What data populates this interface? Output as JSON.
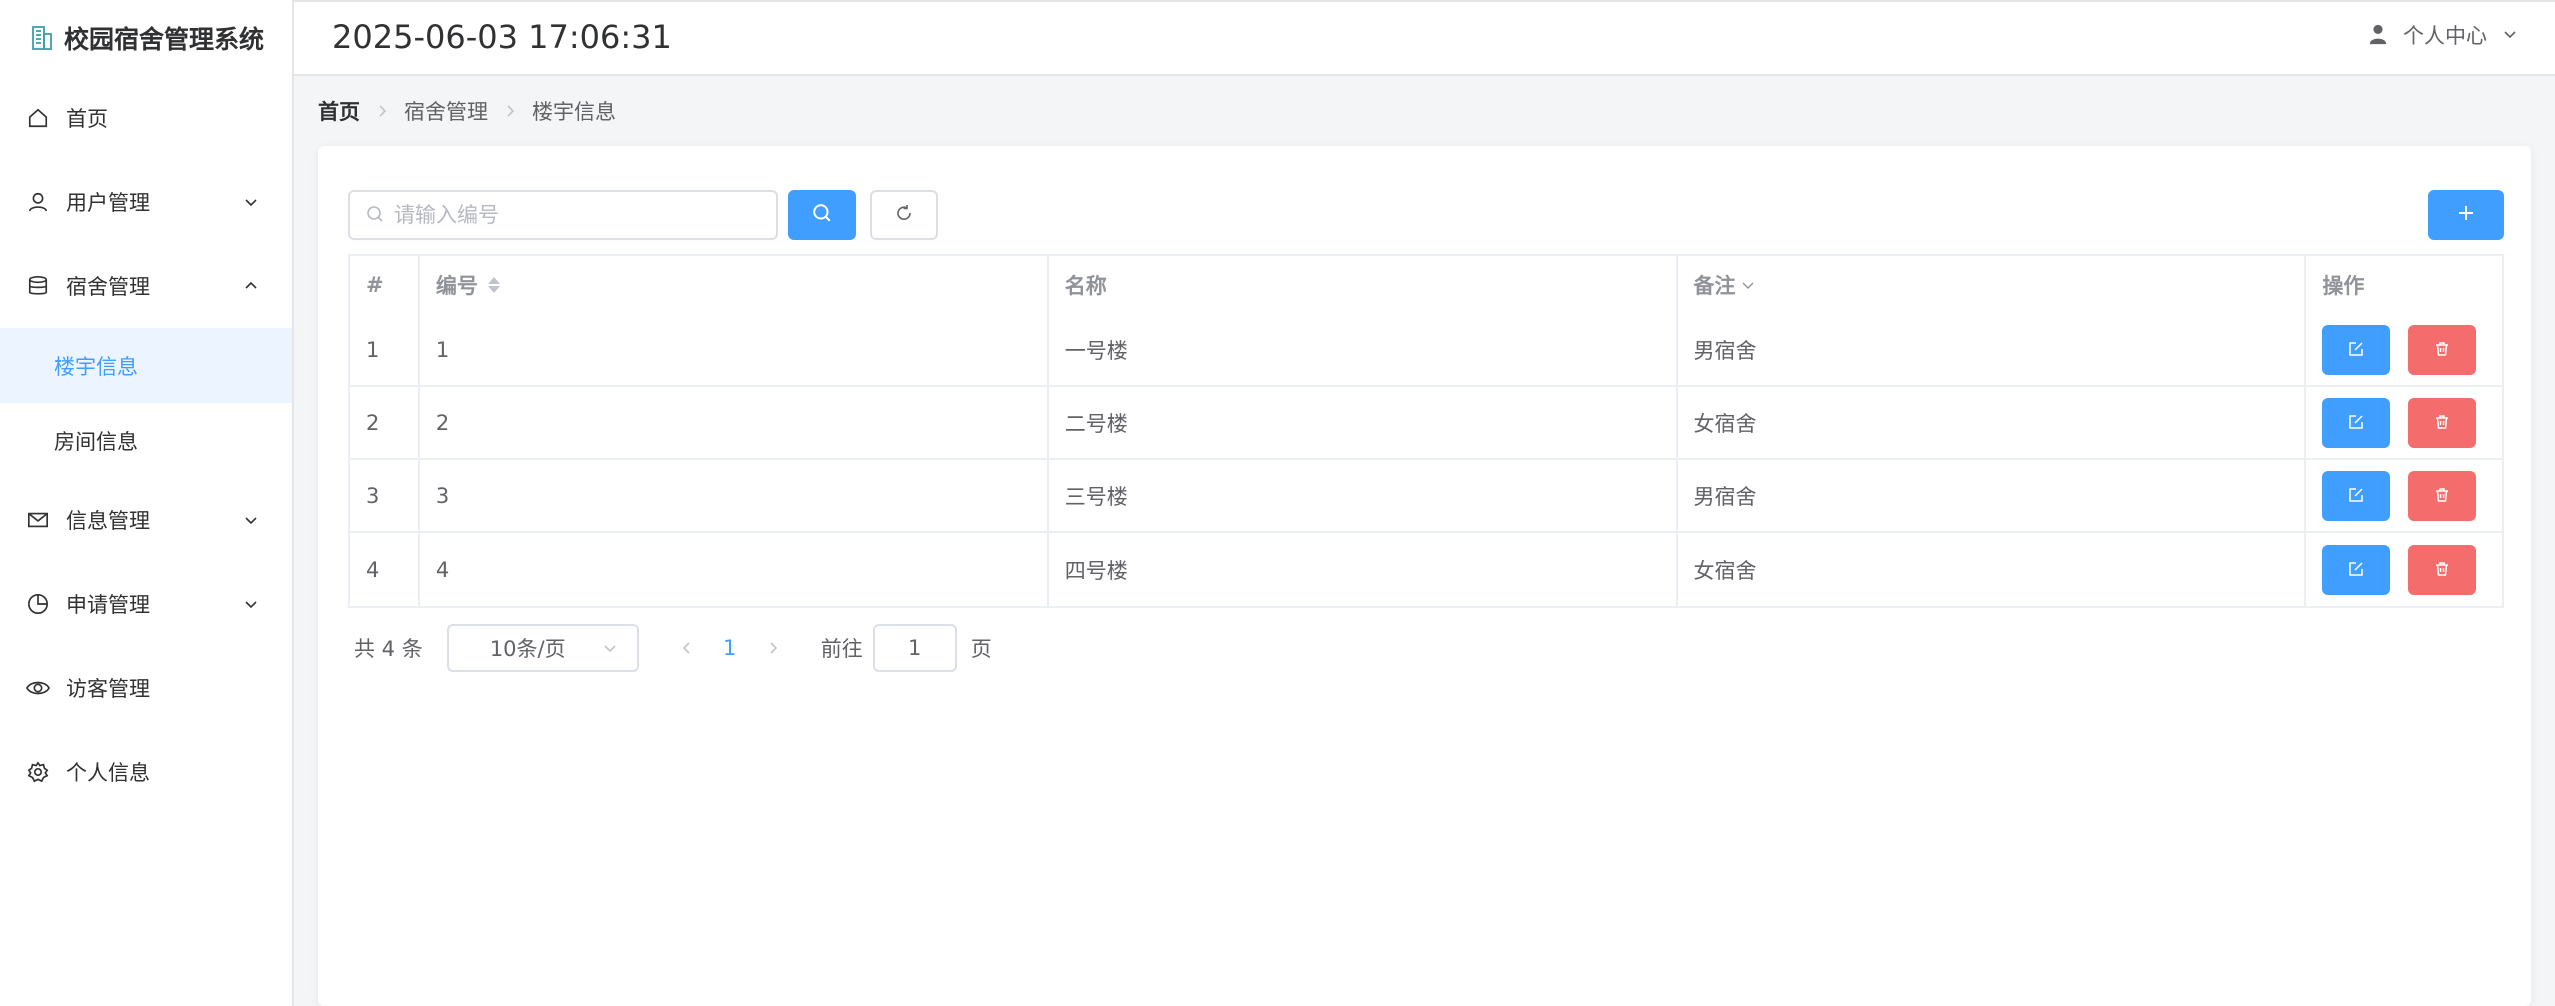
{
  "app": {
    "title": "校园宿舍管理系统",
    "datetime": "2025-06-03 17:06:31"
  },
  "header": {
    "user_menu_label": "个人中心"
  },
  "sidebar": {
    "home": "首页",
    "user_mgmt": "用户管理",
    "dorm_mgmt": "宿舍管理",
    "dorm_sub": {
      "building": "楼宇信息",
      "room": "房间信息"
    },
    "info_mgmt": "信息管理",
    "apply_mgmt": "申请管理",
    "visitor_mgmt": "访客管理",
    "profile": "个人信息"
  },
  "breadcrumb": [
    "首页",
    "宿舍管理",
    "楼宇信息"
  ],
  "search": {
    "placeholder": "请输入编号"
  },
  "table": {
    "headers": [
      "#",
      "编号",
      "名称",
      "备注",
      "操作"
    ],
    "rows": [
      {
        "idx": "1",
        "code": "1",
        "name": "一号楼",
        "remark": "男宿舍"
      },
      {
        "idx": "2",
        "code": "2",
        "name": "二号楼",
        "remark": "女宿舍"
      },
      {
        "idx": "3",
        "code": "3",
        "name": "三号楼",
        "remark": "男宿舍"
      },
      {
        "idx": "4",
        "code": "4",
        "name": "四号楼",
        "remark": "女宿舍"
      }
    ]
  },
  "pagination": {
    "total": "共 4 条",
    "page_size": "10条/页",
    "current_page": "1",
    "goto_label": "前往",
    "goto_value": "1",
    "unit": "页"
  },
  "colors": {
    "primary": "#409eff",
    "danger": "#f56c6c",
    "active_bg": "#ecf5ff"
  },
  "icons": {
    "logo": "building-icon",
    "home": "home-icon",
    "user": "user-icon",
    "dorm": "database-icon",
    "info": "mail-icon",
    "apply": "pie-chart-icon",
    "visitor": "eye-icon",
    "profile": "gear-icon",
    "search": "search-icon",
    "reset": "refresh-icon",
    "add": "plus-icon",
    "edit": "edit-icon",
    "delete": "trash-icon"
  }
}
